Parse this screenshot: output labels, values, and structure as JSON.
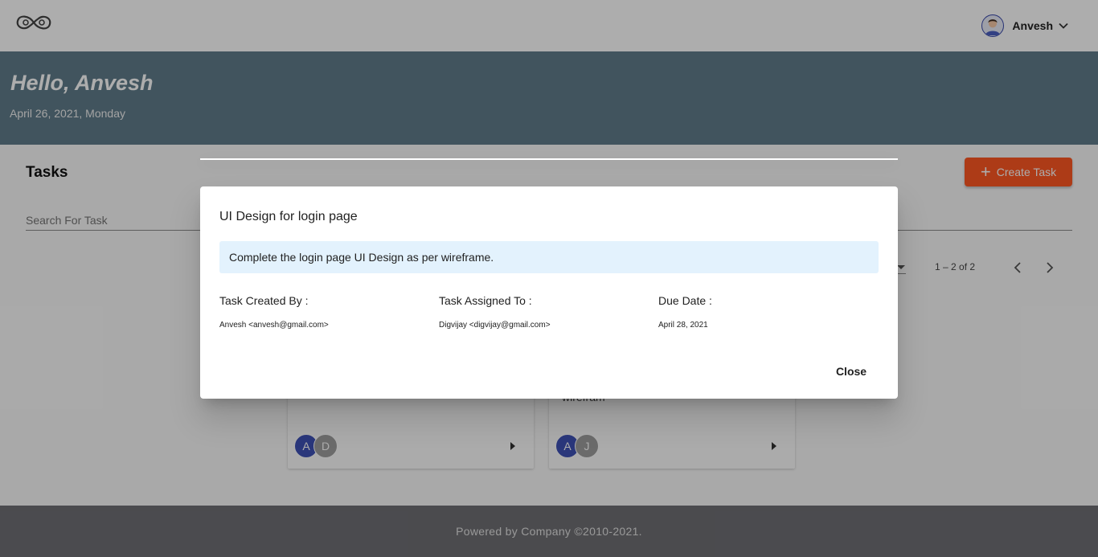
{
  "header": {
    "logo_icon": "infinity-logo-icon",
    "user_name": "Anvesh",
    "avatar_icon": "user-avatar-icon",
    "menu_icon": "chevron-down-icon"
  },
  "banner": {
    "greeting": "Hello, Anvesh",
    "date": "April 26, 2021, Monday",
    "color": "#607d8b"
  },
  "tasks": {
    "title": "Tasks",
    "create_label": "Create Task",
    "create_icon": "plus-icon",
    "search_placeholder": "Search For Task",
    "accent_color": "#ff5722"
  },
  "pagination": {
    "range": "1 – 2 of 2",
    "prev_icon": "chevron-left-icon",
    "next_icon": "chevron-right-icon"
  },
  "cards": [
    {
      "text": "",
      "avatars": [
        "A",
        "D"
      ]
    },
    {
      "text": "wirefram",
      "avatars": [
        "A",
        "J"
      ]
    }
  ],
  "dialog": {
    "title": "UI Design for login page",
    "description": "Complete the login page UI Design as per wireframe.",
    "created_by_label": "Task Created By :",
    "created_by_value": "Anvesh <anvesh@gmail.com>",
    "assigned_to_label": "Task Assigned To :",
    "assigned_to_value": "Digvijay <digvijay@gmail.com>",
    "due_date_label": "Due Date :",
    "due_date_value": "April 28, 2021",
    "close_label": "Close"
  },
  "footer": {
    "text": "Powered by Company ©2010-2021."
  }
}
